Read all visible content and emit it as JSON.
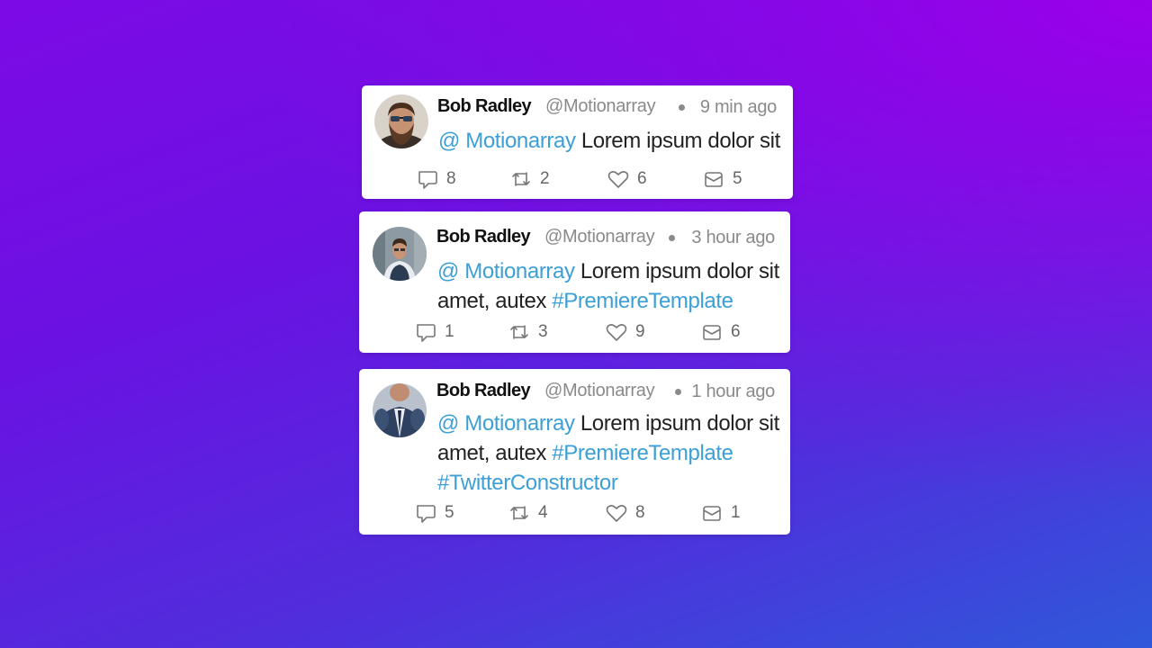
{
  "tweets": [
    {
      "name": "Bob Radley",
      "handle": "@Motionarray",
      "time": "9 min ago",
      "mention": "@ Motionarray",
      "text": " Lorem ipsum dolor sit",
      "hashtags": [],
      "replies": "8",
      "retweets": "2",
      "likes": "6",
      "messages": "5"
    },
    {
      "name": "Bob Radley",
      "handle": "@Motionarray",
      "time": "3 hour ago",
      "mention": "@ Motionarray",
      "text": " Lorem ipsum dolor sit amet, autex ",
      "hashtags": [
        "#PremiereTemplate"
      ],
      "replies": "1",
      "retweets": "3",
      "likes": "9",
      "messages": "6"
    },
    {
      "name": "Bob Radley",
      "handle": "@Motionarray",
      "time": "1 hour ago",
      "mention": "@ Motionarray",
      "text": " Lorem ipsum dolor sit amet, autex ",
      "hashtags": [
        "#PremiereTemplate",
        "#TwitterConstructor"
      ],
      "replies": "5",
      "retweets": "4",
      "likes": "8",
      "messages": "1"
    }
  ],
  "icons": {
    "reply": "reply-icon",
    "retweet": "retweet-icon",
    "like": "heart-icon",
    "message": "envelope-icon"
  },
  "colors": {
    "link": "#3c9fd6",
    "background_start": "#8a06e8",
    "background_end": "#2f58da"
  }
}
